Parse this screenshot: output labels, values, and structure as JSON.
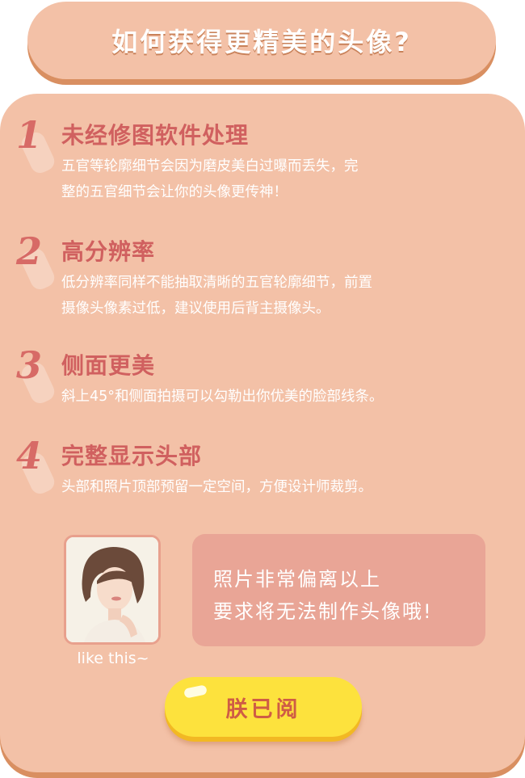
{
  "title": "如何获得更精美的头像?",
  "tips": [
    {
      "number": "1",
      "heading": "未经修图软件处理",
      "lines": [
        "五官等轮廓细节会因为磨皮美白过曝而丢失，完",
        "整的五官细节会让你的头像更传神！"
      ]
    },
    {
      "number": "2",
      "heading": "高分辨率",
      "lines": [
        "低分辨率同样不能抽取清晰的五官轮廓细节，前置",
        "摄像头像素过低，建议使用后背主摄像头。"
      ]
    },
    {
      "number": "3",
      "heading": "侧面更美",
      "lines": [
        "斜上45°和侧面拍摄可以勾勒出你优美的脸部线条。"
      ]
    },
    {
      "number": "4",
      "heading": "完整显示头部",
      "lines": [
        "头部和照片顶部预留一定空间，方便设计师裁剪。"
      ]
    }
  ],
  "example": {
    "caption": "like this~"
  },
  "warning": {
    "lines": [
      "照片非常偏离以上",
      "要求将无法制作头像哦!"
    ]
  },
  "confirm_button": {
    "label": "朕已阅"
  }
}
